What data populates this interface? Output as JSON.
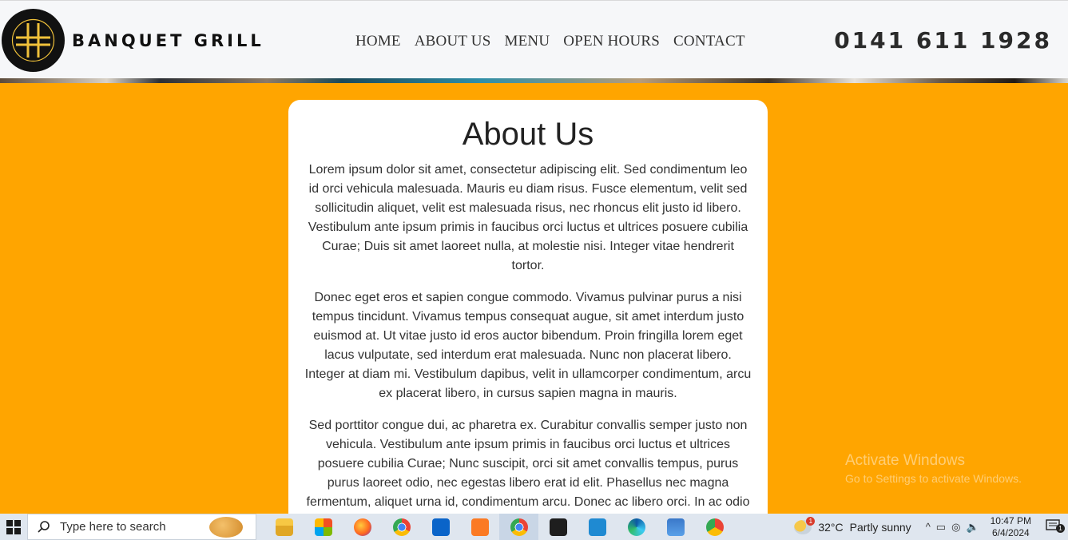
{
  "header": {
    "brand": "BANQUET GRILL",
    "nav": [
      "HOME",
      "ABOUT US",
      "MENU",
      "OPEN HOURS",
      "CONTACT"
    ],
    "phone": "0141 611 1928"
  },
  "about": {
    "title": "About Us",
    "paragraphs": [
      "Lorem ipsum dolor sit amet, consectetur adipiscing elit. Sed condimentum leo id orci vehicula malesuada. Mauris eu diam risus. Fusce elementum, velit sed sollicitudin aliquet, velit est malesuada risus, nec rhoncus elit justo id libero. Vestibulum ante ipsum primis in faucibus orci luctus et ultrices posuere cubilia Curae; Duis sit amet laoreet nulla, at molestie nisi. Integer vitae hendrerit tortor.",
      "Donec eget eros et sapien congue commodo. Vivamus pulvinar purus a nisi tempus tincidunt. Vivamus tempus consequat augue, sit amet interdum justo euismod at. Ut vitae justo id eros auctor bibendum. Proin fringilla lorem eget lacus vulputate, sed interdum erat malesuada. Nunc non placerat libero. Integer at diam mi. Vestibulum dapibus, velit in ullamcorper condimentum, arcu ex placerat libero, in cursus sapien magna in mauris.",
      "Sed porttitor congue dui, ac pharetra ex. Curabitur convallis semper justo non vehicula. Vestibulum ante ipsum primis in faucibus orci luctus et ultrices posuere cubilia Curae; Nunc suscipit, orci sit amet convallis tempus, purus purus laoreet odio, nec egestas libero erat id elit. Phasellus nec magna fermentum, aliquet urna id, condimentum arcu. Donec ac libero orci. In ac odio"
    ]
  },
  "watermark": {
    "line1": "Activate Windows",
    "line2": "Go to Settings to activate Windows."
  },
  "taskbar": {
    "search_placeholder": "Type here to search",
    "apps": [
      "file-explorer",
      "microsoft-store",
      "firefox",
      "chrome",
      "mail",
      "xampp",
      "chrome-active",
      "terminal",
      "vscode",
      "edge",
      "remote-desktop",
      "chrome-profile"
    ],
    "weather_temp": "32°C",
    "weather_text": "Partly sunny",
    "weather_badge": "1",
    "time": "10:47 PM",
    "date": "6/4/2024",
    "notification_count": "1"
  },
  "colors": {
    "page_background": "#ffa500",
    "card_background": "#ffffff",
    "header_background": "#f6f7f9",
    "logo_accent": "#f0c13a"
  }
}
